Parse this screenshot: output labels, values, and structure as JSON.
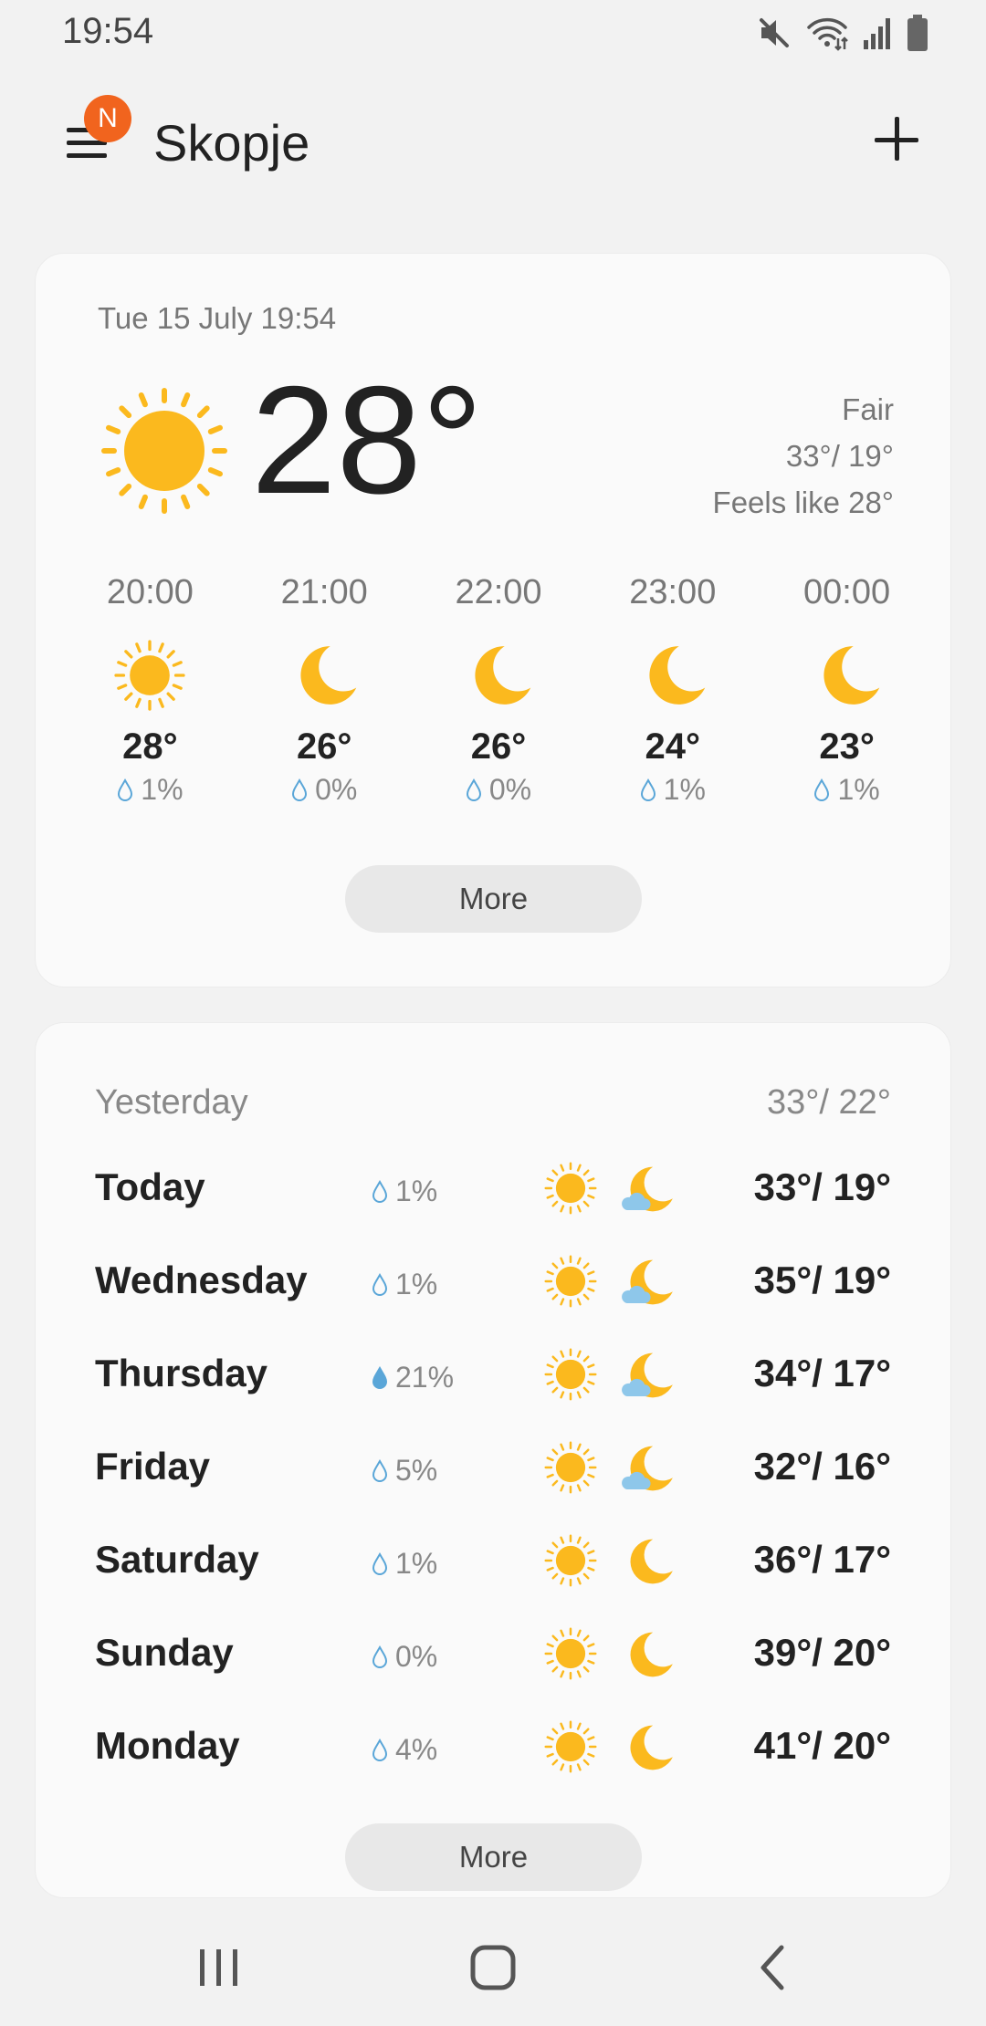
{
  "status_bar": {
    "time": "19:54",
    "icons": [
      "mute-icon",
      "wifi-icon",
      "signal-icon",
      "battery-icon"
    ]
  },
  "header": {
    "city": "Skopje",
    "badge": "N",
    "menu_icon": "hamburger-menu-icon",
    "add_icon": "plus-icon"
  },
  "current": {
    "datetime": "Tue 15 July 19:54",
    "temperature": "28°",
    "condition": "Fair",
    "high_low": "33°/ 19°",
    "feels_like": "Feels like 28°",
    "icon": "sun-icon"
  },
  "hourly": [
    {
      "time": "20:00",
      "icon": "sun-icon",
      "temp": "28°",
      "precip": "1%"
    },
    {
      "time": "21:00",
      "icon": "moon-icon",
      "temp": "26°",
      "precip": "0%"
    },
    {
      "time": "22:00",
      "icon": "moon-icon",
      "temp": "26°",
      "precip": "0%"
    },
    {
      "time": "23:00",
      "icon": "moon-icon",
      "temp": "24°",
      "precip": "1%"
    },
    {
      "time": "00:00",
      "icon": "moon-icon",
      "temp": "23°",
      "precip": "1%"
    }
  ],
  "more_label": "More",
  "yesterday": {
    "label": "Yesterday",
    "temps": "33°/ 22°"
  },
  "daily": [
    {
      "day": "Today",
      "precip": "1%",
      "day_icon": "sun-icon",
      "night_icon": "moon-cloud-icon",
      "temps": "33°/ 19°"
    },
    {
      "day": "Wednesday",
      "precip": "1%",
      "day_icon": "sun-icon",
      "night_icon": "moon-cloud-icon",
      "temps": "35°/ 19°"
    },
    {
      "day": "Thursday",
      "precip": "21%",
      "day_icon": "sun-icon",
      "night_icon": "moon-cloud-icon",
      "temps": "34°/ 17°"
    },
    {
      "day": "Friday",
      "precip": "5%",
      "day_icon": "sun-icon",
      "night_icon": "moon-cloud-icon",
      "temps": "32°/ 16°"
    },
    {
      "day": "Saturday",
      "precip": "1%",
      "day_icon": "sun-icon",
      "night_icon": "moon-icon",
      "temps": "36°/ 17°"
    },
    {
      "day": "Sunday",
      "precip": "0%",
      "day_icon": "sun-icon",
      "night_icon": "moon-icon",
      "temps": "39°/ 20°"
    },
    {
      "day": "Monday",
      "precip": "4%",
      "day_icon": "sun-icon",
      "night_icon": "moon-icon",
      "temps": "41°/ 20°"
    }
  ],
  "nav": {
    "recent": "recent-apps-icon",
    "home": "home-icon",
    "back": "back-icon"
  },
  "colors": {
    "sun": "#fbb91e",
    "cloud": "#8ec7ea",
    "drop": "#5aa6d8",
    "badge": "#f1641e"
  }
}
